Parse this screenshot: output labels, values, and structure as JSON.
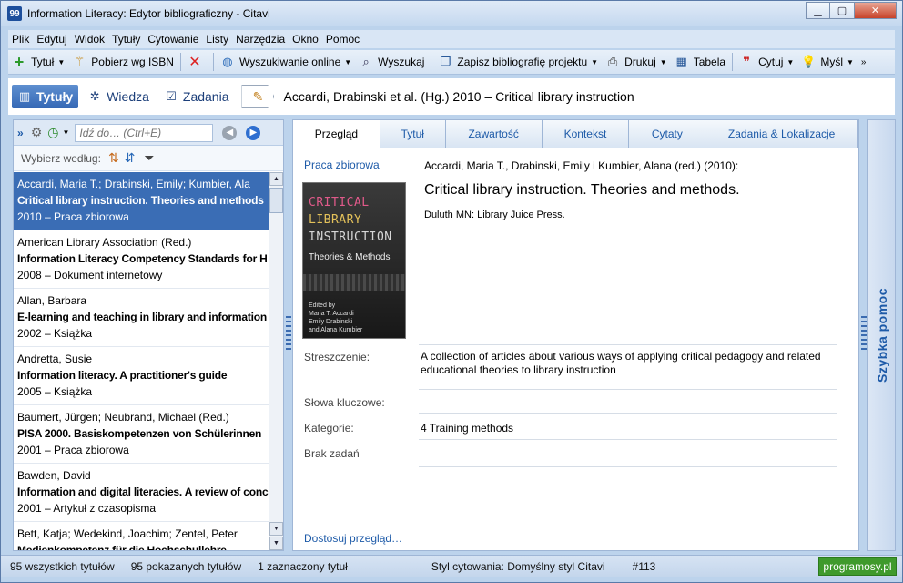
{
  "window": {
    "title": "Information Literacy: Edytor bibliograficzny - Citavi",
    "app_icon": "99"
  },
  "menu": [
    "Plik",
    "Edytuj",
    "Widok",
    "Tytuły",
    "Cytowanie",
    "Listy",
    "Narzędzia",
    "Okno",
    "Pomoc"
  ],
  "toolbar": {
    "add_title": "Tytuł",
    "isbn": "Pobierz wg ISBN",
    "online_search": "Wyszukiwanie online",
    "search": "Wyszukaj",
    "save_bib": "Zapisz bibliografię projektu",
    "print": "Drukuj",
    "table": "Tabela",
    "cite": "Cytuj",
    "thought": "Myśl"
  },
  "nav": {
    "tabs": [
      "Tytuły",
      "Wiedza",
      "Zadania"
    ],
    "reference_title": "Accardi, Drabinski et al. (Hg.) 2010 – Critical library instruction"
  },
  "left": {
    "search_placeholder": "Idź do… (Ctrl+E)",
    "sort_label": "Wybierz według:",
    "items": [
      {
        "author": "Accardi, Maria T.; Drabinski, Emily; Kumbier, Ala",
        "title": "Critical library instruction. Theories and methods",
        "meta": "2010 – Praca zbiorowa"
      },
      {
        "author": "American Library Association (Red.)",
        "title": "Information Literacy Competency Standards for H",
        "meta": "2008 – Dokument internetowy"
      },
      {
        "author": "Allan, Barbara",
        "title": "E-learning and teaching in library and information",
        "meta": "2002 – Książka"
      },
      {
        "author": "Andretta, Susie",
        "title": "Information literacy. A practitioner's guide",
        "meta": "2005 – Książka"
      },
      {
        "author": "Baumert, Jürgen; Neubrand, Michael (Red.)",
        "title": "PISA 2000. Basiskompetenzen von Schülerinnen",
        "meta": "2001 – Praca zbiorowa"
      },
      {
        "author": "Bawden, David",
        "title": "Information and digital literacies. A review of conc",
        "meta": "2001 – Artykuł z czasopisma"
      },
      {
        "author": "Bett, Katja; Wedekind, Joachim; Zentel, Peter",
        "title": "Medienkompetenz für die Hochschullehre",
        "meta": ""
      }
    ]
  },
  "right": {
    "tabs": [
      "Przegląd",
      "Tytuł",
      "Zawartość",
      "Kontekst",
      "Cytaty",
      "Zadania & Lokalizacje"
    ],
    "type": "Praca zbiorowa",
    "citation_line": "Accardi, Maria T., Drabinski, Emily i Kumbier, Alana (red.) (2010):",
    "citation_title": "Critical library instruction. Theories and methods.",
    "publisher": "Duluth MN: Library Juice Press.",
    "cover": {
      "lines": [
        "CRITICAL",
        "LIBRARY",
        "INSTRUCTION"
      ],
      "subtitle": "Theories & Methods",
      "editors": [
        "Edited by",
        "Maria T. Accardi",
        "Emily Drabinski",
        "and Alana Kumbier"
      ]
    },
    "fields": {
      "abstract_label": "Streszczenie:",
      "abstract_value": "A collection of articles about various ways of applying critical pedagogy and related educational theories to library instruction",
      "keywords_label": "Słowa kluczowe:",
      "keywords_value": "",
      "categories_label": "Kategorie:",
      "categories_value": "4 Training methods",
      "tasks_label": "Brak zadań"
    },
    "customize": "Dostosuj przegląd…"
  },
  "quickhelp": "Szybka pomoc",
  "status": {
    "all_titles": "95 wszystkich tytułów",
    "shown_titles": "95 pokazanych tytułów",
    "selected": "1 zaznaczony tytuł",
    "citation_style": "Styl cytowania: Domyślny styl Citavi",
    "number": "#113",
    "badge": "programosy.pl"
  }
}
